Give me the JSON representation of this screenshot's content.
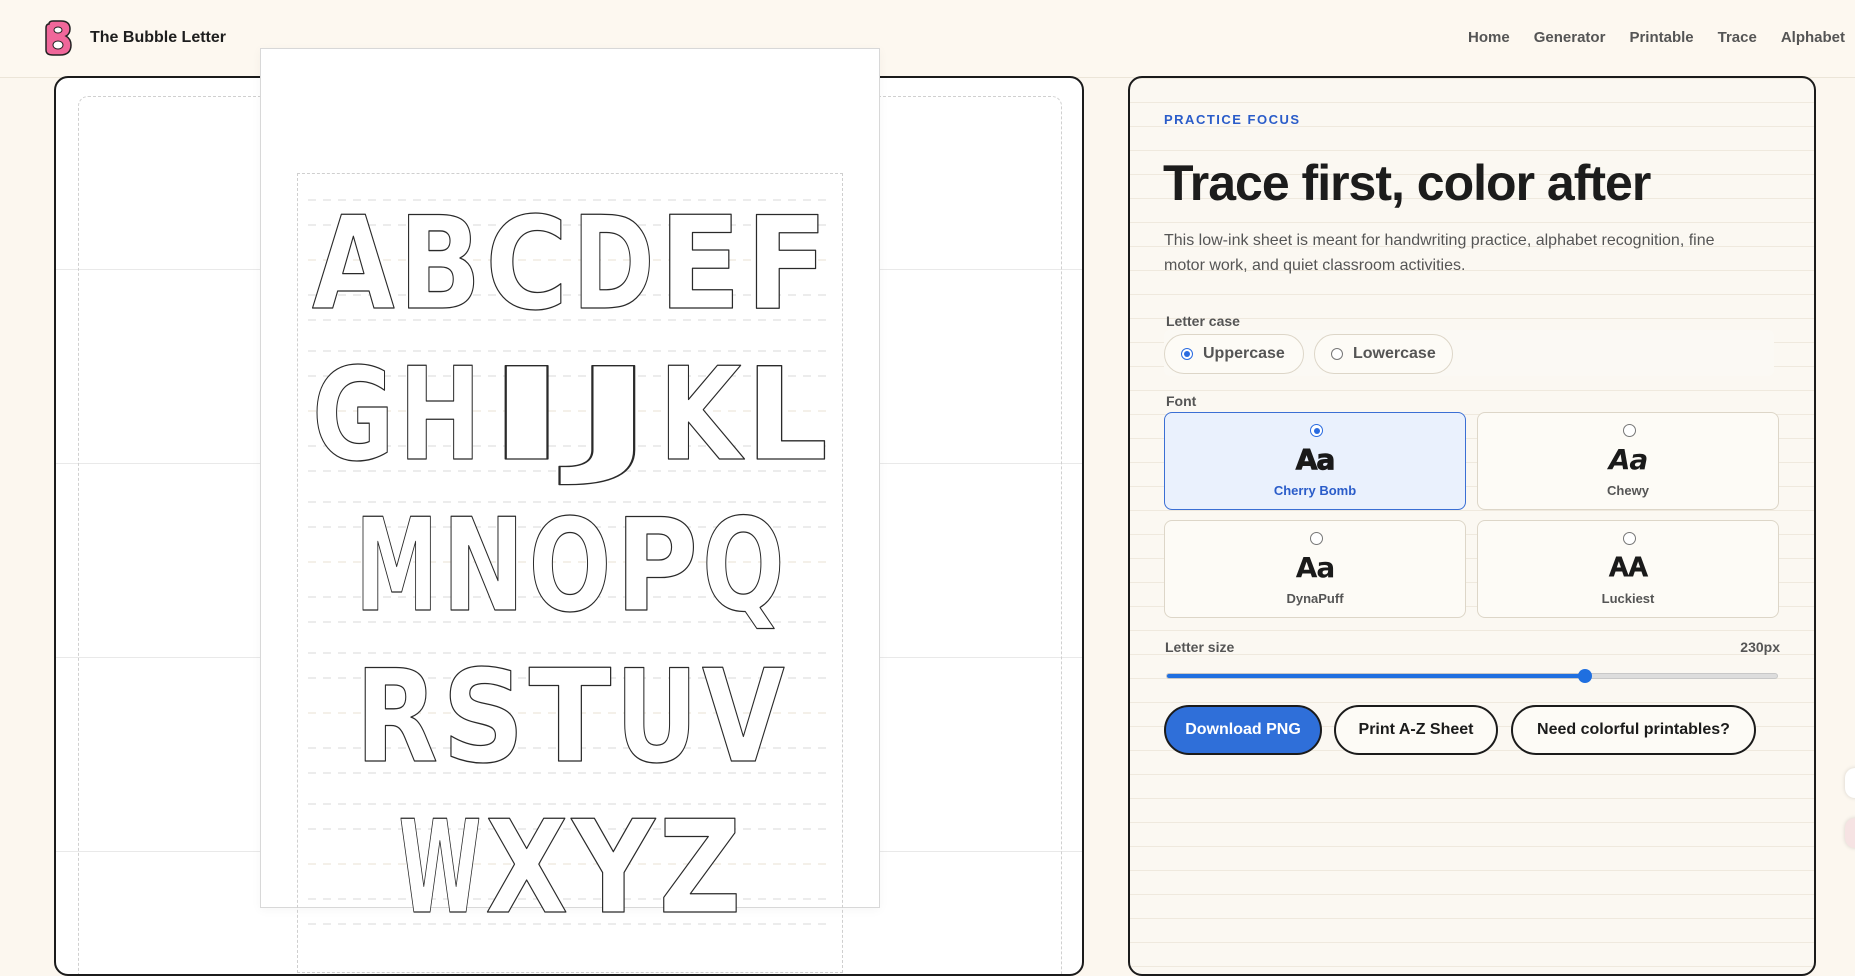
{
  "header": {
    "brand": "The Bubble Letter",
    "logo_icon": "bubble-b-logo-icon",
    "nav": [
      {
        "label": "Home"
      },
      {
        "label": "Generator"
      },
      {
        "label": "Printable"
      },
      {
        "label": "Trace"
      },
      {
        "label": "Alphabet"
      }
    ]
  },
  "preview": {
    "letters": "ABCDEFGHIJKLMNOPQRSTUVWXYZ",
    "rows": [
      "ABCDEF",
      "GHIJKL",
      "MNOPQ",
      "RSTUV",
      "WXYZ"
    ]
  },
  "panel": {
    "kicker": "PRACTICE FOCUS",
    "headline": "Trace first, color after",
    "intro": "This low-ink sheet is meant for handwriting practice, alphabet recognition, fine motor work, and quiet classroom activities.",
    "letter_case": {
      "label": "Letter case",
      "options": [
        {
          "label": "Uppercase",
          "selected": true
        },
        {
          "label": "Lowercase",
          "selected": false
        }
      ]
    },
    "font": {
      "label": "Font",
      "options": [
        {
          "sample": "Aa",
          "name": "Cherry Bomb",
          "selected": true
        },
        {
          "sample": "Aa",
          "name": "Chewy",
          "selected": false
        },
        {
          "sample": "Aa",
          "name": "DynaPuff",
          "selected": false
        },
        {
          "sample": "AA",
          "name": "Luckiest",
          "selected": false
        }
      ]
    },
    "letter_size": {
      "label": "Letter size",
      "value_text": "230px",
      "fraction": 0.685
    },
    "buttons": {
      "download": "Download PNG",
      "print": "Print A-Z Sheet",
      "colorful": "Need colorful printables?"
    }
  },
  "colors": {
    "accent": "#2f6fd9",
    "kicker": "#2a5cc9",
    "background": "#fcf7ef"
  }
}
